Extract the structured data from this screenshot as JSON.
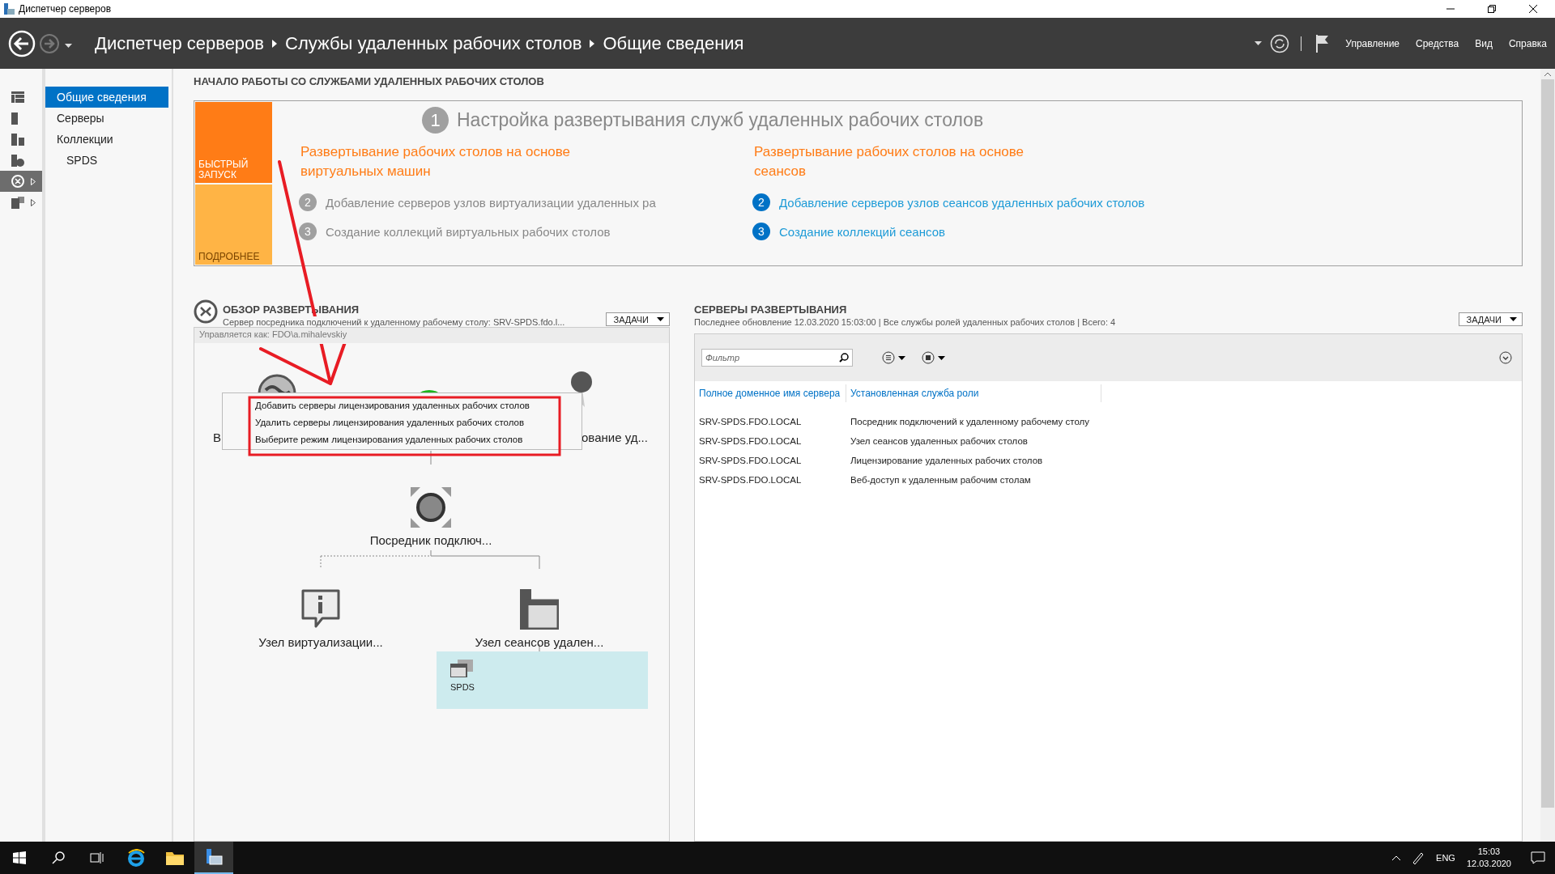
{
  "window": {
    "title": "Диспетчер серверов"
  },
  "header": {
    "breadcrumb": [
      "Диспетчер серверов",
      "Службы удаленных рабочих столов",
      "Общие сведения"
    ],
    "menu": [
      "Управление",
      "Средства",
      "Вид",
      "Справка"
    ]
  },
  "rail": [
    {
      "kind": "dashboard",
      "selected": false,
      "expandable": false
    },
    {
      "kind": "server",
      "selected": false,
      "expandable": false
    },
    {
      "kind": "servers",
      "selected": false,
      "expandable": false
    },
    {
      "kind": "files",
      "selected": false,
      "expandable": false
    },
    {
      "kind": "remote",
      "selected": true,
      "expandable": true
    },
    {
      "kind": "storage",
      "selected": false,
      "expandable": true
    }
  ],
  "nav": [
    {
      "label": "Общие сведения",
      "selected": true
    },
    {
      "label": "Серверы",
      "selected": false
    },
    {
      "label": "Коллекции",
      "selected": false,
      "children": [
        {
          "label": "SPDS",
          "selected": false
        }
      ]
    }
  ],
  "quick_start": {
    "heading": "НАЧАЛО РАБОТЫ СО СЛУЖБАМИ УДАЛЕННЫХ РАБОЧИХ СТОЛОВ",
    "tiles": [
      {
        "label": "БЫСТРЫЙ ЗАПУСК",
        "selected": true
      },
      {
        "label": "ПОДРОБНЕЕ",
        "selected": false
      }
    ],
    "step": {
      "number": "1",
      "title": "Настройка развертывания служб удаленных рабочих столов"
    },
    "columns": [
      {
        "title": "Развертывание рабочих столов на основе виртуальных машин",
        "enabled": false,
        "steps": [
          {
            "number": "2",
            "label": "Добавление серверов узлов виртуализации удаленных ра"
          },
          {
            "number": "3",
            "label": "Создание коллекций виртуальных рабочих столов"
          }
        ]
      },
      {
        "title": "Развертывание рабочих столов на основе сеансов",
        "enabled": true,
        "steps": [
          {
            "number": "2",
            "label": "Добавление серверов узлов сеансов удаленных рабочих столов"
          },
          {
            "number": "3",
            "label": "Создание коллекций сеансов"
          }
        ]
      }
    ]
  },
  "overview": {
    "title": "ОБЗОР РАЗВЕРТЫВАНИЯ",
    "subtitle": "Сервер посредника подключений к удаленному рабочему столу: SRV-SPDS.fdo.l...",
    "tasks": "ЗАДАЧИ",
    "managed_as": "Управляется как: FDO\\a.mihalevskiy",
    "nodes": [
      {
        "kind": "web",
        "label": "В"
      },
      {
        "kind": "gateway"
      },
      {
        "kind": "licensing",
        "label": "ование уд..."
      },
      {
        "kind": "broker",
        "label": "Посредник подключ..."
      },
      {
        "kind": "virtualization",
        "label": "Узел виртуализации..."
      },
      {
        "kind": "session",
        "label": "Узел сеансов удален..."
      }
    ],
    "collection": {
      "label": "SPDS"
    },
    "context_menu": [
      "Добавить серверы лицензирования удаленных рабочих столов",
      "Удалить серверы лицензирования удаленных рабочих столов",
      "Выберите режим лицензирования удаленных рабочих столов"
    ]
  },
  "servers": {
    "title": "СЕРВЕРЫ РАЗВЕРТЫВАНИЯ",
    "subtitle": "Последнее обновление 12.03.2020 15:03:00 | Все службы ролей удаленных рабочих столов  | Всего: 4",
    "tasks": "ЗАДАЧИ",
    "filter": {
      "placeholder": "Фильтр"
    },
    "columns": [
      "Полное доменное имя сервера",
      "Установленная служба роли"
    ],
    "rows": [
      [
        "SRV-SPDS.FDO.LOCAL",
        "Посредник подключений к удаленному рабочему столу"
      ],
      [
        "SRV-SPDS.FDO.LOCAL",
        "Узел сеансов удаленных рабочих столов"
      ],
      [
        "SRV-SPDS.FDO.LOCAL",
        "Лицензирование удаленных рабочих столов"
      ],
      [
        "SRV-SPDS.FDO.LOCAL",
        "Веб-доступ к удаленным рабочим столам"
      ]
    ]
  },
  "taskbar": {
    "language": "ENG",
    "time": "15:03",
    "date": "12.03.2020"
  }
}
